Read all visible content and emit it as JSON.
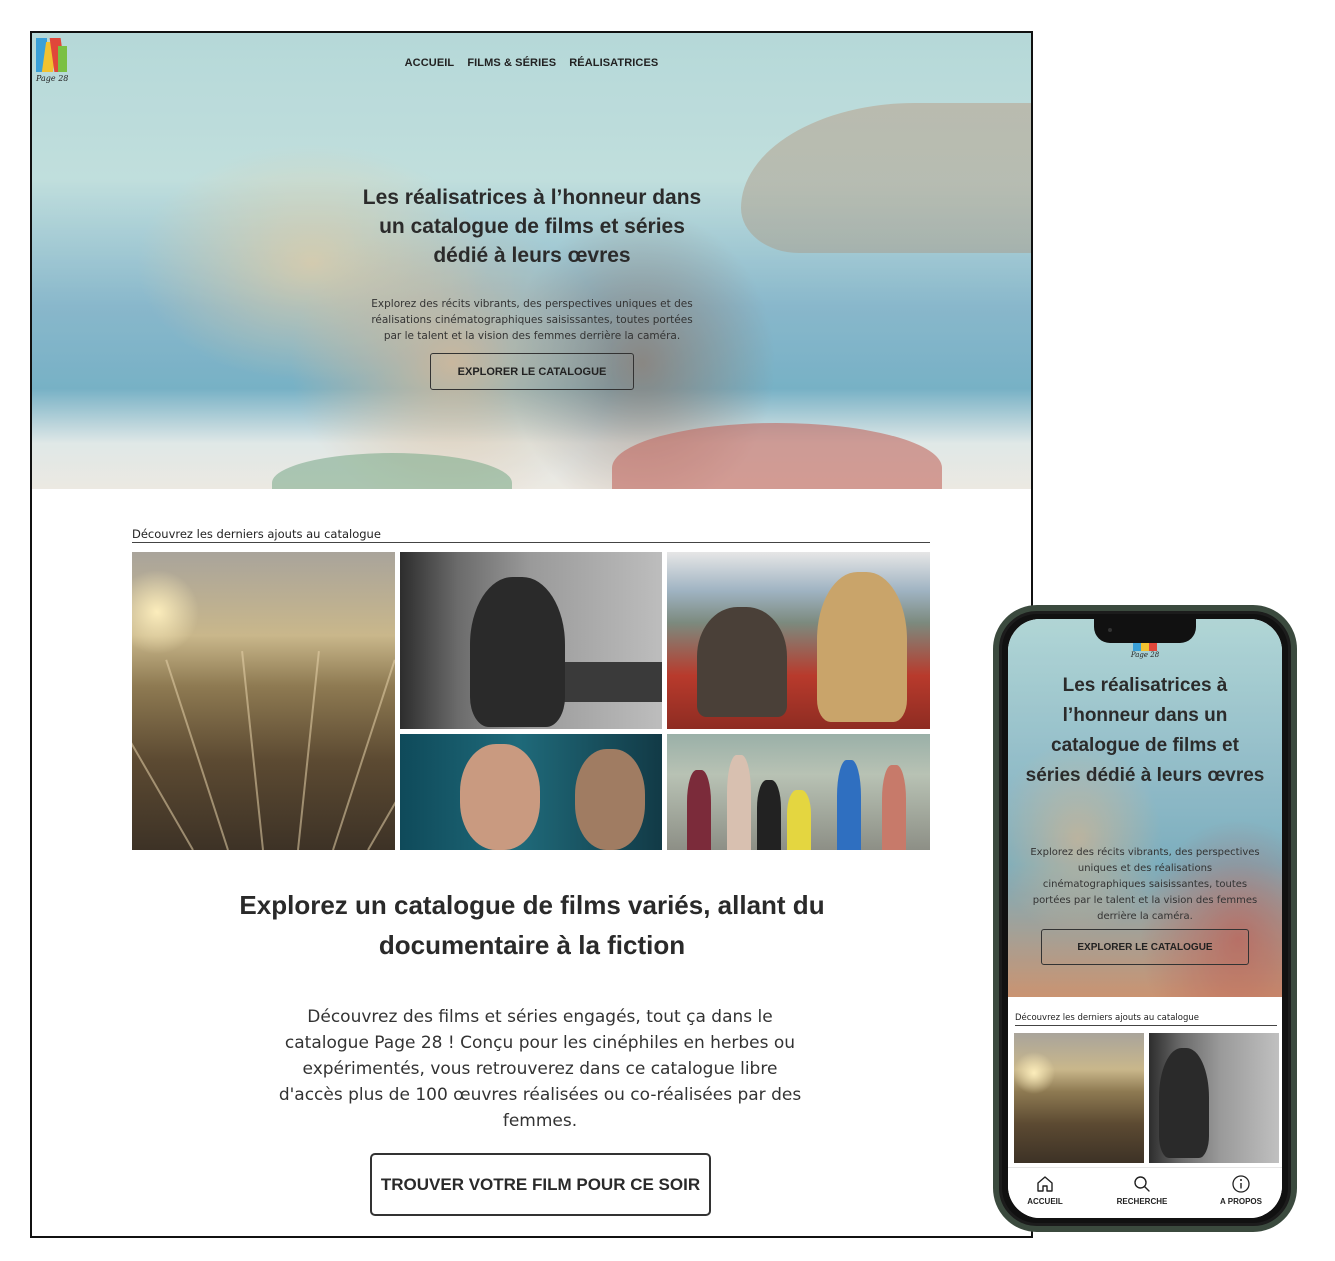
{
  "desktop": {
    "logo_caption": "Page 28",
    "nav": [
      "ACCUEIL",
      "FILMS & SÉRIES",
      "RÉALISATRICES"
    ],
    "hero": {
      "title": "Les réalisatrices à l’honneur dans un catalogue de films et séries dédié à leurs œvres",
      "subtitle": "Explorez des récits vibrants, des perspectives uniques et des réalisations cinématographiques saisissantes, toutes portées par le talent et la vision des femmes derrière la caméra.",
      "button": "EXPLORER LE CATALOGUE"
    },
    "latest_label": "Découvrez les derniers ajouts au catalogue",
    "section": {
      "title": "Explorez un catalogue de films variés, allant du documentaire à la fiction",
      "body": "Découvrez des films et séries engagés, tout ça dans le catalogue Page 28 ! Conçu pour les cinéphiles en herbes ou expérimentés, vous retrouverez dans ce catalogue libre d'accès plus de 100 œuvres réalisées ou co-réalisées par des femmes.",
      "button": "TROUVER VOTRE FILM POUR CE SOIR"
    }
  },
  "mobile": {
    "logo_caption": "Page 28",
    "hero": {
      "title": "Les réalisatrices à l’honneur dans un catalogue de films et séries dédié à leurs œvres",
      "subtitle": "Explorez des récits vibrants, des perspectives uniques et des réalisations cinématographiques saisissantes, toutes portées par le talent et la vision des femmes derrière la caméra.",
      "button": "EXPLORER LE CATALOGUE"
    },
    "latest_label": "Découvrez les derniers ajouts au catalogue",
    "tabs": [
      "ACCUEIL",
      "RECHERCHE",
      "A PROPOS"
    ]
  },
  "colors": {
    "logo": [
      "#f2c230",
      "#e0473a",
      "#3aa0d8",
      "#7bc043",
      "#9b59b6"
    ],
    "text": "#2a2a2a",
    "phone_frame": "#3b4a3e"
  },
  "icons": [
    "home-icon",
    "search-icon",
    "info-icon"
  ]
}
